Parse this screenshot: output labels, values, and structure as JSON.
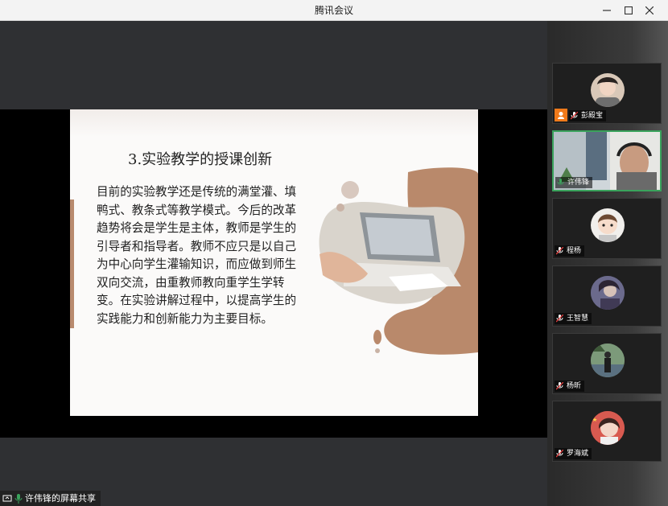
{
  "window": {
    "title": "腾讯会议"
  },
  "slide": {
    "title": "3.实验教学的授课创新",
    "body": "目前的实验教学还是传统的满堂灌、填鸭式、教条式等教学模式。今后的改革趋势将会是学生是主体，教师是学生的引导者和指导者。教师不应只是以自己为中心向学生灌输知识，而应做到师生双向交流，由重教师教向重学生学转变。在实验讲解过程中，以提高学生的实践能力和创新能力为主要目标。"
  },
  "share_indicator": {
    "label": "许伟锋的屏幕共享"
  },
  "participants": [
    {
      "name": "彭殿宝",
      "host": true,
      "mic_muted": true,
      "video": false
    },
    {
      "name": "许伟锋",
      "host": false,
      "mic_muted": false,
      "video": true
    },
    {
      "name": "程杨",
      "host": false,
      "mic_muted": true,
      "video": false
    },
    {
      "name": "王智慧",
      "host": false,
      "mic_muted": true,
      "video": false
    },
    {
      "name": "杨昕",
      "host": false,
      "mic_muted": true,
      "video": false
    },
    {
      "name": "罗海斌",
      "host": false,
      "mic_muted": true,
      "video": false
    }
  ],
  "colors": {
    "accent_green": "#3aa35c",
    "host_orange": "#f07a1a",
    "slide_brown": "#b88a6e"
  },
  "icons": {
    "minimize": "minimize-icon",
    "maximize": "maximize-icon",
    "close": "close-icon",
    "mic_muted": "mic-muted-icon",
    "mic": "mic-icon",
    "screen_share": "screen-share-icon"
  }
}
